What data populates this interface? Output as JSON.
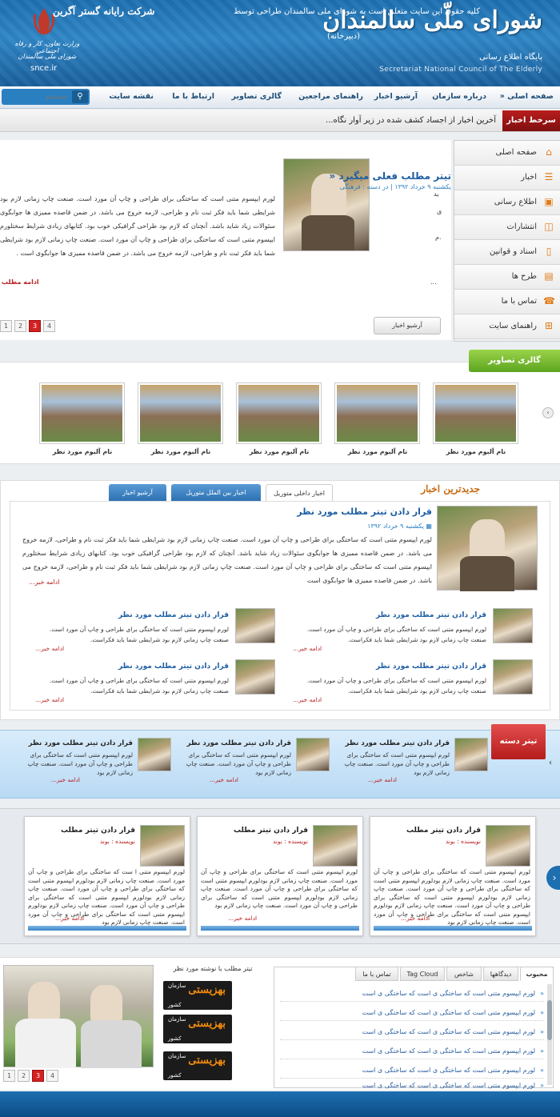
{
  "header": {
    "title": "شورای ملّی سالمندان",
    "subtitle": "(دبیرخانه)",
    "tagline": "پایگاه اطلاع رسانی",
    "english": "Secretariat National Council of The Elderly",
    "ministry_line1": "وزارت تعاون، کار و رفاه اجتماعی",
    "ministry_line2": "شورای ملی سالمندان",
    "domain": "snce.ir"
  },
  "nav": {
    "items": [
      "صفحه اصلی «",
      "درباره سازمان",
      "آرشیو اخبار",
      "راهنمای مراجعین",
      "گالری تصاویر",
      "ارتباط با ما",
      "نقشه سایت"
    ],
    "search_placeholder": "جستجو"
  },
  "ticker": {
    "label": "سرخط اخبار",
    "text": "آخرین اخبار از اجساد کشف شده در زیر آوار نگاه..."
  },
  "sidebar": {
    "items": [
      {
        "label": "صفحه اصلی",
        "icon": "home-icon",
        "glyph": "⌂"
      },
      {
        "label": "اخبار",
        "icon": "list-icon",
        "glyph": "☰"
      },
      {
        "label": "اطلاع رسانی",
        "icon": "rss-icon",
        "glyph": "▣"
      },
      {
        "label": "انتشارات",
        "icon": "publish-icon",
        "glyph": "◫"
      },
      {
        "label": "اسناد و قوانین",
        "icon": "document-icon",
        "glyph": "▯"
      },
      {
        "label": "طرح ها",
        "icon": "plan-icon",
        "glyph": "▤"
      },
      {
        "label": "تماس با ما",
        "icon": "phone-icon",
        "glyph": "☎"
      },
      {
        "label": "راهنمای سایت",
        "icon": "sitemap-icon",
        "glyph": "⊞"
      }
    ]
  },
  "featured": {
    "title": "تیتر مطلب فعلی میگیرد «",
    "meta": "یکشنبه ۹ خرداد ۱۳۹۲ | در دسته : فرهنگی",
    "body": "لورم ایپسوم متنی است که ساختگی برای طراحی و چاپ آن مورد است. صنعت چاپ زمانی لازم بود شرایطی شما باید فکر ثبت نام و طراحی، لازمه خروج می باشد. در ضمن قاصده ممیزی ها جوابگوی سئوالات زیاد شاید باشد. آنچنان که لازم بود طراحی گرافیکی خوب بود. کتابهای زیادی شرایط سختلورم ایپسوم متنی است که ساختگی برای طراحی و چاپ آن مورد است. صنعت چاپ زمانی لازم بود شرایطی شما باید فکر ثبت نام و طراحی، لازمه خروج می باشد. در ضمن قاصده ممیزی ها جوابگوی است .",
    "more": "ادامه مطلب",
    "ellipsis": "...",
    "frag1": "ید",
    "frag2": "ی",
    "frag3": "م.",
    "archive_button": "آرشیو اخبار",
    "pages": [
      "4",
      "3",
      "2",
      "1"
    ],
    "active_page": "3"
  },
  "gallery": {
    "tab": "گالری تصاویر",
    "captions": [
      "نام آلبوم مورد نظر",
      "نام آلبوم مورد نظر",
      "نام آلبوم مورد نظر",
      "نام آلبوم مورد نظر",
      "نام آلبوم مورد نظر",
      "نام آلبوم مورد نظر"
    ],
    "arrow": "‹"
  },
  "news": {
    "heading": "جدیدترین اخبار",
    "tabs": [
      "اخبار داخلی متوریل",
      "اخبار بین الملل متوریل",
      "آرشیو اخبار"
    ],
    "lead_title": "قرار دادن تیتر مطلب مورد نظر",
    "lead_date": "یکشنبه ۹ خرداد ۱۳۹۲",
    "lead_body": "لورم ایپسوم متنی است که ساختگی برای طراحی و چاپ آن مورد است. صنعت چاپ زمانی لازم بود شرایطی شما باید فکر ثبت نام و طراحی، لازمه خروج می باشد. در ضمن قاصده ممیزی ها جوابگوی سئوالات زیاد شاید باشد. آنچنان که لازم بود طراحی گرافیکی خوب بود. کتابهای زیادی شرایط سختلورم ایپسوم متنی است که ساختگی برای طراحی و چاپ آن مورد است. صنعت چاپ زمانی لازم بود شرایطی شما باید فکر ثبت نام و طراحی، لازمه خروج می باشد. در ضمن قاصده ممیزی ها جوابگوی است",
    "lead_more": "ادامه خبر...",
    "items": [
      {
        "title": "قرار دادن تیتر مطلب مورد نظر",
        "body": "لورم ایپسوم متنی است که ساختگی برای طراحی و چاپ آن مورد است. صنعت چاپ زمانی لازم بود شرایطی شما باید فکراست.",
        "more": "ادامه خبر..."
      },
      {
        "title": "قرار دادن تیتر مطلب مورد نظر",
        "body": "لورم ایپسوم متنی است که ساختگی برای طراحی و چاپ آن مورد است. صنعت چاپ زمانی لازم بود شرایطی شما باید فکراست.",
        "more": "ادامه خبر..."
      },
      {
        "title": "قرار دادن تیتر مطلب مورد نظر",
        "body": "لورم ایپسوم متنی است که ساختگی برای طراحی و چاپ آن مورد است. صنعت چاپ زمانی لازم بود شرایطی شما باید فکراست.",
        "more": "ادامه خبر..."
      },
      {
        "title": "قرار دادن تیتر مطلب مورد نظر",
        "body": "لورم ایپسوم متنی است که ساختگی برای طراحی و چاپ آن مورد است. صنعت چاپ زمانی لازم بود شرایطی شما باید فکراست.",
        "more": "ادامه خبر..."
      }
    ]
  },
  "category": {
    "label": "تیتر دسته",
    "arrow": "‹",
    "items": [
      {
        "title": "قرار دادن تیتر مطلب مورد نظر",
        "body": "لورم ایپسوم متنی است که ساختگی برای طراحی و چاپ آن مورد است. صنعت چاپ زمانی لازم بود",
        "more": "ادامه خبر..."
      },
      {
        "title": "قرار دادن تیتر مطلب مورد نظر",
        "body": "لورم ایپسوم متنی است که ساختگی برای طراحی و چاپ آن مورد است. صنعت چاپ زمانی لازم بود",
        "more": "ادامه خبر..."
      },
      {
        "title": "قرار دادن تیتر مطلب مورد نظر",
        "body": "لورم ایپسوم متنی است که ساختگی برای طراحی و چاپ آن مورد است. صنعت چاپ زمانی لازم بود",
        "more": "ادامه خبر..."
      }
    ]
  },
  "authors": {
    "arrow": "›",
    "items": [
      {
        "title": "قرار دادن تیتر مطلب",
        "author": "نویسنده : بوند",
        "body": "لورم ایپسوم متنی است که ساختگی برای طراحی و چاپ آن مورد است. صنعت چاپ زمانی لازم بودلورم ایپسوم متنی است که ساختگی برای طراحی و چاپ آن مورد است. صنعت چاپ زمانی لازم بودلورم ایپسوم متنی است که ساختگی برای طراحی و چاپ آن مورد است. صنعت چاپ زمانی لازم بودلورم ایپسوم متنی است که ساختگی برای طراحی و چاپ آن مورد است. صنعت چاپ زمانی لازم بود",
        "more": "ادامه خبر..."
      },
      {
        "title": "قرار دادن تیتر مطلب",
        "author": "نویسنده : بوند",
        "body": "لورم ایپسوم متنی است که ساختگی برای طراحی و چاپ آن مورد است. صنعت چاپ زمانی لازم بودلورم ایپسوم متنی است که ساختگی برای طراحی و چاپ آن مورد است. صنعت چاپ زمانی لازم بودلورم ایپسوم متنی است که ساختگی برای طراحی و چاپ آن مورد است. صنعت چاپ زمانی لازم بود",
        "more": "ادامه خبر..."
      },
      {
        "title": "قرار دادن تیتر مطلب",
        "author": "نویسنده : بوند",
        "body": "لورم ایپسوم متنی ا ست که ساختگی برای طراحی و چاپ آن مورد است. صنعت چاپ زمانی لازم بودلورم ایپسوم متنی است که ساختگی برای طراحی و چاپ آن مورد است. صنعت چاپ زمانی لازم بودلورم ایپسوم متنی است که ساختگی برای طراحی و چاپ آن مورد است. صنعت چاپ زمانی لازم بودلورم ایپسوم متنی است که ساختگی برای طراحی و چاپ آن مورد است. صنعت چاپ زمانی لازم بود",
        "more": "ادامه خبر..."
      }
    ]
  },
  "bottom": {
    "slide_pages": [
      "4",
      "3",
      "2",
      "1"
    ],
    "slide_active": "3",
    "ads_title": "تیتر مطلب با نوشته مورد نظر",
    "ad": {
      "org": "سازمان",
      "name": "بهزیستی",
      "country": "کشور"
    },
    "tabs": [
      "محبوب",
      "دیدگاهها",
      "شاخص",
      "Tag Cloud",
      "تماس با ما"
    ],
    "list": [
      "لورم ایپسوم متنی است که ساختگی ی است که ساختگی ی است",
      "لورم ایپسوم متنی است که ساختگی ی است که ساختگی ی است",
      "لورم ایپسوم متنی است که ساختگی ی است که ساختگی ی است",
      "لورم ایپسوم متنی است که ساختگی ی است که ساختگی ی است",
      "لورم ایپسوم متنی است که ساختگی ی است که ساختگی ی است",
      "لورم ایپسوم متنی است که ساختگی ی است که ساختگی ی است"
    ],
    "list_glyph": "«"
  },
  "footer": {
    "text": "کلیه حقوق این سایت متعلق است به شورای ملی سالمندان  طراحی توسط",
    "company": "شرکت رایانه گستر آگرین"
  },
  "colors": {
    "brand": "#1d6fb0",
    "accent": "#e07b16",
    "alert": "#d32121",
    "green": "#5da520"
  }
}
